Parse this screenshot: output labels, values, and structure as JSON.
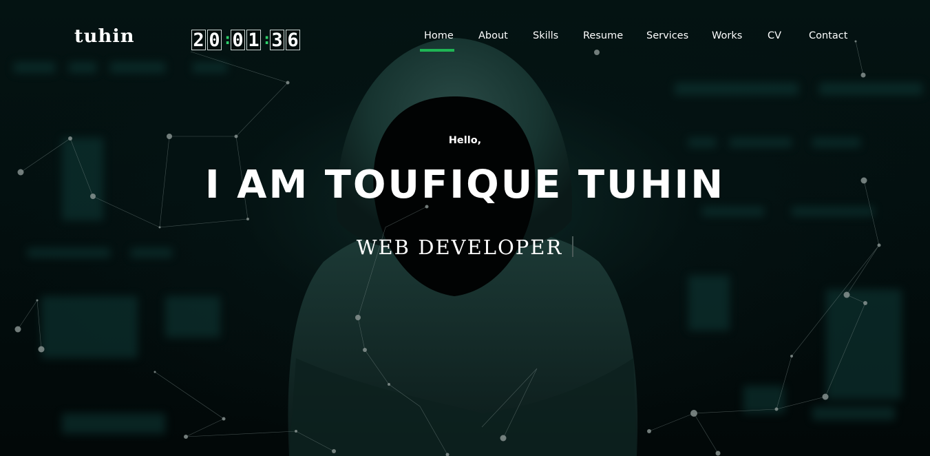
{
  "header": {
    "logo": "tuhin",
    "clock": {
      "hours": [
        "2",
        "0"
      ],
      "minutes": [
        "0",
        "1"
      ],
      "seconds": [
        "3",
        "6"
      ],
      "separator": ":"
    },
    "nav": {
      "items": [
        "Home",
        "About",
        "Skills",
        "Resume",
        "Services",
        "Works",
        "CV",
        "Contact"
      ],
      "active": "Home"
    }
  },
  "hero": {
    "greeting": "Hello,",
    "name": "I AM TOUFIQUE TUHIN",
    "role": "WEB DEVELOPER"
  },
  "colors": {
    "accent": "#1fb655",
    "background": "#031010",
    "text": "#ffffff"
  }
}
